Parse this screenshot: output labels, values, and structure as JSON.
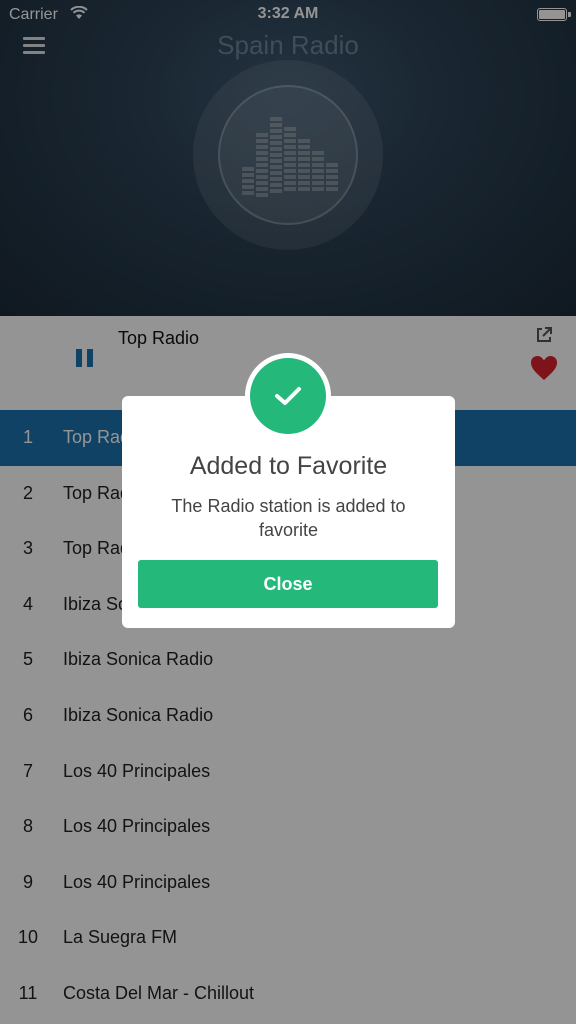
{
  "status_bar": {
    "carrier": "Carrier",
    "time": "3:32 AM"
  },
  "header": {
    "title": "Spain Radio",
    "background_color": "#2a3f52"
  },
  "player": {
    "now_playing": "Top Radio",
    "accent_color": "#1d72b0",
    "favorite_color": "#d9232e"
  },
  "stations": [
    {
      "number": "1",
      "name": "Top Radio",
      "active": true
    },
    {
      "number": "2",
      "name": "Top Radio"
    },
    {
      "number": "3",
      "name": "Top Radio"
    },
    {
      "number": "4",
      "name": "Ibiza Sonica Radio"
    },
    {
      "number": "5",
      "name": "Ibiza Sonica Radio"
    },
    {
      "number": "6",
      "name": "Ibiza Sonica Radio"
    },
    {
      "number": "7",
      "name": "Los 40 Principales"
    },
    {
      "number": "8",
      "name": "Los 40 Principales"
    },
    {
      "number": "9",
      "name": "Los 40 Principales"
    },
    {
      "number": "10",
      "name": "La Suegra FM"
    },
    {
      "number": "11",
      "name": "Costa Del Mar - Chillout"
    }
  ],
  "dialog": {
    "title": "Added to Favorite",
    "message": "The Radio station is added to favorite",
    "close_label": "Close",
    "success_color": "#24b87a"
  }
}
